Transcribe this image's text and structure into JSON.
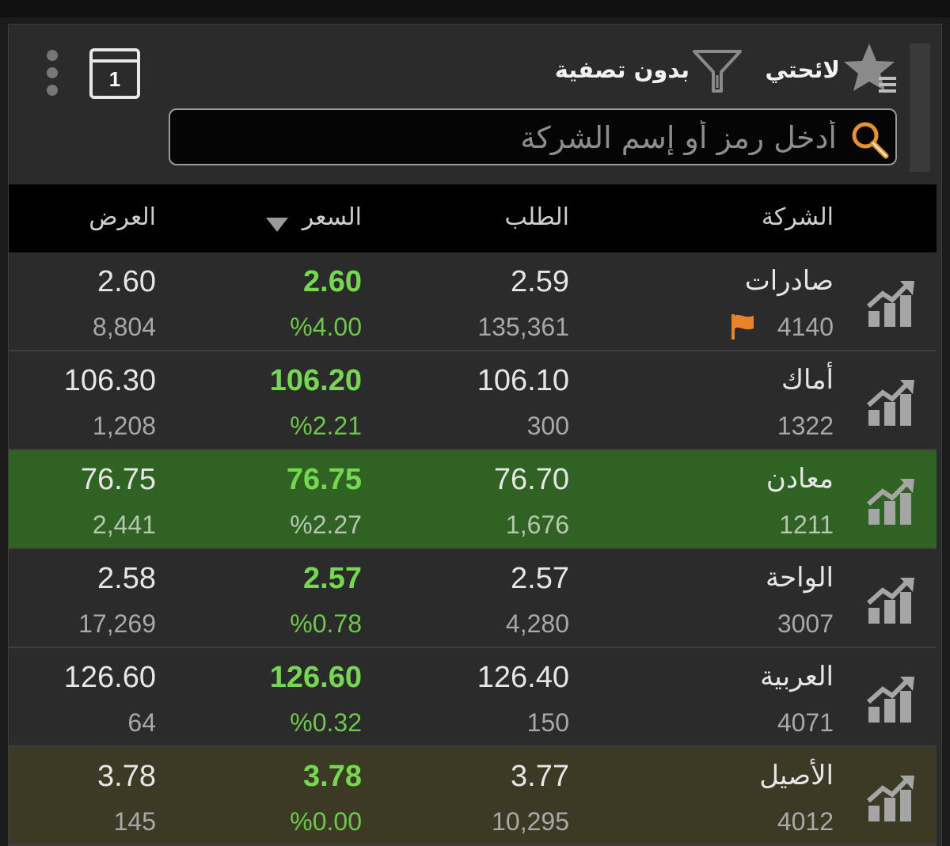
{
  "header": {
    "favorites_label": "لائحتي",
    "filter_label": "بدون تصفية",
    "calendar_day": "1"
  },
  "search": {
    "placeholder": "أدخل رمز أو إسم الشركة",
    "value": ""
  },
  "table": {
    "columns": {
      "company": "الشركة",
      "bid": "الطلب",
      "price": "السعر",
      "offer": "العرض"
    },
    "rows": [
      {
        "name": "صادرات",
        "code": "4140",
        "bid": "2.59",
        "bid_qty": "135,361",
        "price": "2.60",
        "change": "%4.00",
        "offer": "2.60",
        "offer_qty": "8,804",
        "flag": true,
        "highlight": "none"
      },
      {
        "name": "أماك",
        "code": "1322",
        "bid": "106.10",
        "bid_qty": "300",
        "price": "106.20",
        "change": "%2.21",
        "offer": "106.30",
        "offer_qty": "1,208",
        "flag": false,
        "highlight": "none"
      },
      {
        "name": "معادن",
        "code": "1211",
        "bid": "76.70",
        "bid_qty": "1,676",
        "price": "76.75",
        "change": "%2.27",
        "offer": "76.75",
        "offer_qty": "2,441",
        "flag": false,
        "highlight": "green"
      },
      {
        "name": "الواحة",
        "code": "3007",
        "bid": "2.57",
        "bid_qty": "4,280",
        "price": "2.57",
        "change": "%0.78",
        "offer": "2.58",
        "offer_qty": "17,269",
        "flag": false,
        "highlight": "none"
      },
      {
        "name": "العربية",
        "code": "4071",
        "bid": "126.40",
        "bid_qty": "150",
        "price": "126.60",
        "change": "%0.32",
        "offer": "126.60",
        "offer_qty": "64",
        "flag": false,
        "highlight": "none"
      },
      {
        "name": "الأصيل",
        "code": "4012",
        "bid": "3.77",
        "bid_qty": "10,295",
        "price": "3.78",
        "change": "%0.00",
        "offer": "3.78",
        "offer_qty": "145",
        "flag": false,
        "highlight": "olive"
      }
    ]
  },
  "colors": {
    "up_green": "#74d94e",
    "highlight_green": "#2f6223",
    "highlight_olive": "#3c3a25",
    "search_accent": "#e8932a",
    "flag": "#e8832a"
  }
}
